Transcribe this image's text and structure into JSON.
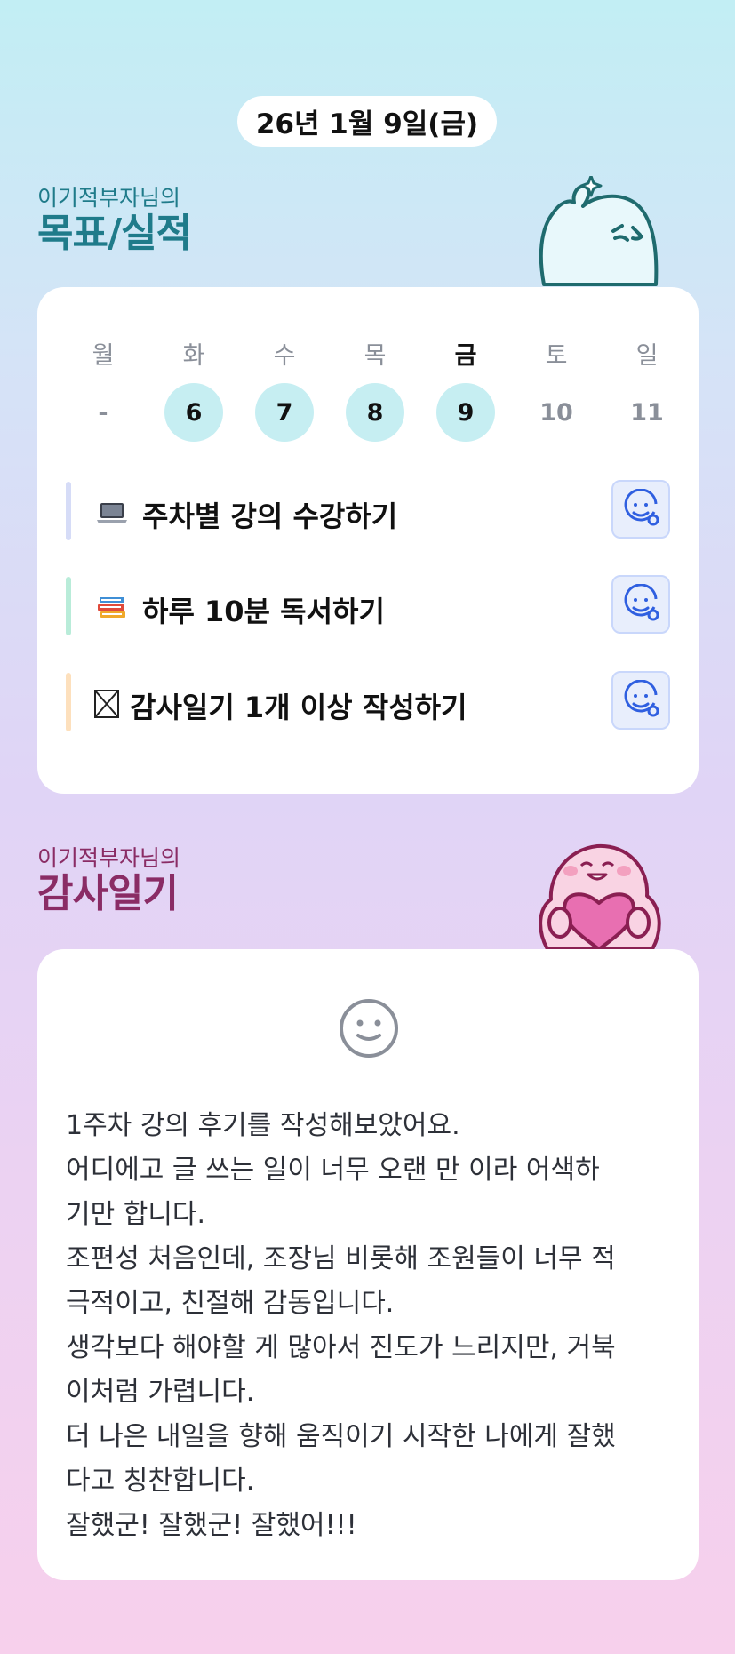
{
  "date_label": "26년 1월 9일(금)",
  "goals_section": {
    "subtitle": "이기적부자님의",
    "title": "목표/실적"
  },
  "week": {
    "days": [
      {
        "name": "월",
        "num": "-",
        "state": "empty"
      },
      {
        "name": "화",
        "num": "6",
        "state": "done"
      },
      {
        "name": "수",
        "num": "7",
        "state": "done"
      },
      {
        "name": "목",
        "num": "8",
        "state": "done"
      },
      {
        "name": "금",
        "num": "9",
        "state": "done",
        "today": true
      },
      {
        "name": "토",
        "num": "10",
        "state": "empty"
      },
      {
        "name": "일",
        "num": "11",
        "state": "empty"
      }
    ]
  },
  "goals": [
    {
      "icon": "laptop-icon",
      "text": "주차별 강의 수강하기",
      "bar_color": "#d6dcf7"
    },
    {
      "icon": "books-icon",
      "text": "하루 10분 독서하기",
      "bar_color": "#b9ecd9"
    },
    {
      "icon": "checkbox-icon",
      "text": "감사일기 1개 이상 작성하기",
      "bar_color": "#fde0bd"
    }
  ],
  "diary_section": {
    "subtitle": "이기적부자님의",
    "title": "감사일기"
  },
  "diary": {
    "lines": [
      "1주차 강의 후기를 작성해보았어요.",
      "어디에고 글 쓰는 일이 너무 오랜 만 이라 어색하",
      "기만 합니다.",
      "조편성 처음인데, 조장님 비롯해 조원들이 너무 적",
      "극적이고, 친절해 감동입니다.",
      "생각보다 해야할 게 많아서 진도가 느리지만, 거북",
      "이처럼 가렵니다.",
      "더 나은 내일을 향해 움직이기 시작한 나에게 잘했",
      "다고 칭찬합니다.",
      "잘했군! 잘했군! 잘했어!!!"
    ]
  },
  "colors": {
    "accent_teal": "#1f7b8a",
    "accent_plum": "#8a2c65",
    "done_circle": "#c6eef2",
    "status_blue": "#2f5fe0"
  }
}
